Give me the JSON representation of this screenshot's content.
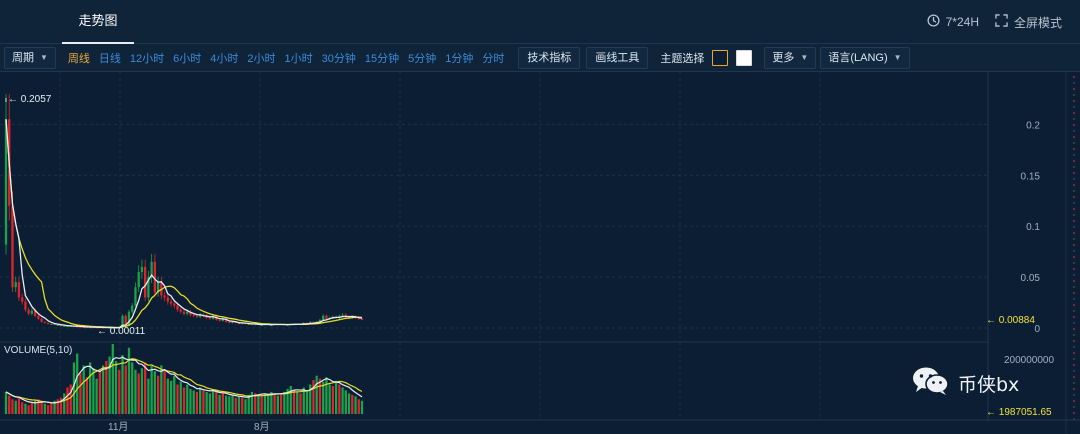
{
  "header": {
    "tab_label": "走势图",
    "clock_label": "7*24H",
    "fullscreen_label": "全屏模式"
  },
  "toolbar": {
    "period_label": "周期",
    "intervals": [
      "周线",
      "日线",
      "12小时",
      "6小时",
      "4小时",
      "2小时",
      "1小时",
      "30分钟",
      "15分钟",
      "5分钟",
      "1分钟",
      "分时"
    ],
    "active_interval": "周线",
    "indicators_label": "技术指标",
    "draw_tools_label": "画线工具",
    "theme_label": "主题选择",
    "more_label": "更多",
    "language_label": "语言(LANG)"
  },
  "colors": {
    "background": "#0b1e33",
    "up": "#1aa34a",
    "down": "#e0262c",
    "ma_yellow": "#e6dc28",
    "ma_white": "#e6ecf2",
    "accent_orange": "#e8a93a",
    "link_blue": "#3c8ad8"
  },
  "watermark": {
    "text": "币侠bx",
    "icon": "wechat-icon"
  },
  "chart_data": [
    {
      "type": "candlestick",
      "title": "",
      "ylim": [
        0,
        0.22
      ],
      "yticks": [
        0.2,
        0.15,
        0.1,
        0.05,
        0
      ],
      "ytick_labels": [
        "0.2",
        "0.15",
        "0.1",
        "0.05",
        "0"
      ],
      "annotations": {
        "max_label": "← 0.2057",
        "max_value": 0.2057,
        "min_label": "← 0.00011",
        "min_value": 0.00011,
        "last_label": "← 0.00884",
        "last_value": 0.00884
      },
      "close": [
        0.205,
        0.12,
        0.04,
        0.045,
        0.03,
        0.026,
        0.018,
        0.014,
        0.017,
        0.012,
        0.009,
        0.006,
        0.005,
        0.004,
        0.004,
        0.003,
        0.003,
        0.002,
        0.002,
        0.002,
        0.002,
        0.0015,
        0.0012,
        0.001,
        0.0009,
        0.0008,
        0.0008,
        0.0007,
        0.0006,
        0.0005,
        0.0005,
        0.0004,
        0.0004,
        0.0003,
        0.0003,
        0.00011,
        0.012,
        0.002,
        0.016,
        0.022,
        0.04,
        0.055,
        0.06,
        0.03,
        0.05,
        0.065,
        0.035,
        0.045,
        0.032,
        0.03,
        0.026,
        0.024,
        0.022,
        0.018,
        0.016,
        0.014,
        0.016,
        0.013,
        0.012,
        0.011,
        0.013,
        0.012,
        0.01,
        0.009,
        0.012,
        0.008,
        0.007,
        0.009,
        0.006,
        0.005,
        0.006,
        0.005,
        0.004,
        0.005,
        0.004,
        0.004,
        0.003,
        0.004,
        0.003,
        0.003,
        0.004,
        0.003,
        0.003,
        0.004,
        0.003,
        0.004,
        0.003,
        0.003,
        0.004,
        0.004,
        0.004,
        0.003,
        0.005,
        0.004,
        0.006,
        0.005,
        0.006,
        0.008,
        0.012,
        0.009,
        0.01,
        0.011,
        0.01,
        0.012,
        0.013,
        0.011,
        0.01,
        0.011,
        0.01,
        0.009,
        0.00884
      ],
      "ma_yellow_note": "longer moving average",
      "ma_white_note": "shorter moving average"
    },
    {
      "type": "bar",
      "title": "VOLUME(5,10)",
      "yticks": [
        200000000
      ],
      "ytick_labels": [
        "200000000"
      ],
      "last_label": "← 1987051.65",
      "last_value": 1987051.65,
      "x_labels": [
        "11月",
        "8月"
      ],
      "values": [
        30,
        25,
        20,
        18,
        22,
        16,
        14,
        12,
        15,
        18,
        20,
        16,
        14,
        12,
        15,
        18,
        20,
        22,
        28,
        36,
        40,
        70,
        82,
        55,
        66,
        50,
        70,
        62,
        48,
        58,
        66,
        72,
        78,
        95,
        72,
        60,
        80,
        66,
        90,
        70,
        60,
        55,
        62,
        70,
        48,
        65,
        58,
        52,
        66,
        60,
        48,
        45,
        52,
        40,
        44,
        36,
        40,
        34,
        32,
        30,
        36,
        33,
        30,
        28,
        32,
        30,
        26,
        28,
        25,
        24,
        26,
        22,
        24,
        22,
        20,
        26,
        30,
        28,
        26,
        25,
        28,
        26,
        30,
        28,
        25,
        28,
        30,
        34,
        38,
        32,
        30,
        28,
        36,
        30,
        40,
        46,
        52,
        48,
        44,
        50,
        40,
        38,
        45,
        40,
        36,
        32,
        28,
        26,
        24,
        20,
        18
      ]
    }
  ]
}
